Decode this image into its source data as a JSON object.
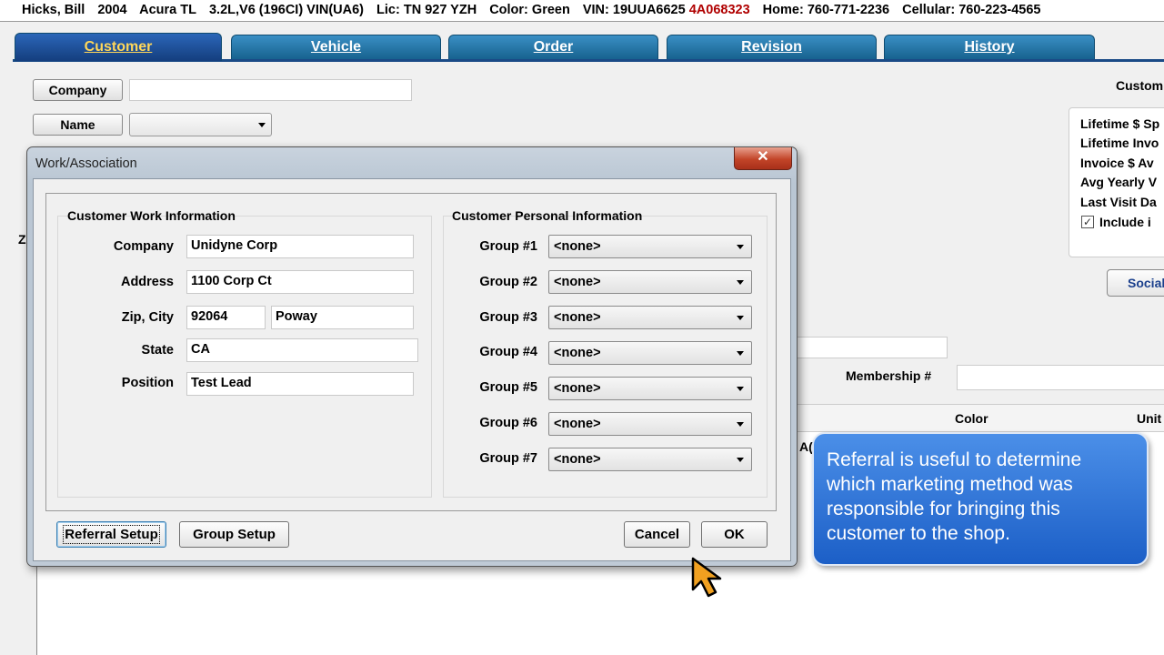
{
  "infobar": {
    "name": "Hicks, Bill",
    "year": "2004",
    "make_model": "Acura TL",
    "engine": "3.2L,V6 (196CI) VIN(UA6)",
    "lic": "Lic: TN 927 YZH",
    "color": "Color: Green",
    "vin_prefix": "VIN: 19UUA6625",
    "vin_suffix": "4A068323",
    "home": "Home: 760-771-2236",
    "cellular": "Cellular: 760-223-4565"
  },
  "tabs": [
    {
      "label": "Customer",
      "active": true
    },
    {
      "label": "Vehicle",
      "active": false
    },
    {
      "label": "Order",
      "active": false
    },
    {
      "label": "Revision",
      "active": false
    },
    {
      "label": "History",
      "active": false
    }
  ],
  "background_form": {
    "company_button": "Company",
    "name_button": "Name",
    "customer_heading": "Custom",
    "stats": [
      "Lifetime $ Sp",
      "Lifetime Invo",
      "Invoice $ Av",
      "Avg Yearly V",
      "Last Visit Da"
    ],
    "include_label": "Include i",
    "include_checked": true,
    "social_button": "Social",
    "membership_label": "Membership #",
    "z_label": "Z",
    "grid_columns": [
      "Color",
      "Unit"
    ],
    "grid_partial": "A("
  },
  "dialog": {
    "title": "Work/Association",
    "close_symbol": "✕",
    "work": {
      "title": "Customer Work Information",
      "company_label": "Company",
      "company_value": "Unidyne Corp",
      "address_label": "Address",
      "address_value": "1100 Corp Ct",
      "zip_city_label": "Zip, City",
      "zip_value": "92064",
      "city_value": "Poway",
      "state_label": "State",
      "state_value": "CA",
      "position_label": "Position",
      "position_value": "Test Lead"
    },
    "personal": {
      "title": "Customer Personal Information",
      "groups": [
        {
          "label": "Group #1",
          "value": "<none>"
        },
        {
          "label": "Group #2",
          "value": "<none>"
        },
        {
          "label": "Group #3",
          "value": "<none>"
        },
        {
          "label": "Group #4",
          "value": "<none>"
        },
        {
          "label": "Group #5",
          "value": "<none>"
        },
        {
          "label": "Group #6",
          "value": "<none>"
        },
        {
          "label": "Group #7",
          "value": "<none>"
        }
      ]
    },
    "buttons": {
      "referral_setup": "Referral Setup",
      "group_setup": "Group Setup",
      "cancel": "Cancel",
      "ok": "OK"
    }
  },
  "callout": {
    "text": "Referral is useful to determine which marketing method was responsible for bringing this customer to the shop."
  },
  "colors": {
    "tab_active": "#1f4f98",
    "tab_inactive": "#1f74a8",
    "callout": "#2d72d8",
    "vin_highlight": "#b00000",
    "cursor": "#f0a020"
  }
}
